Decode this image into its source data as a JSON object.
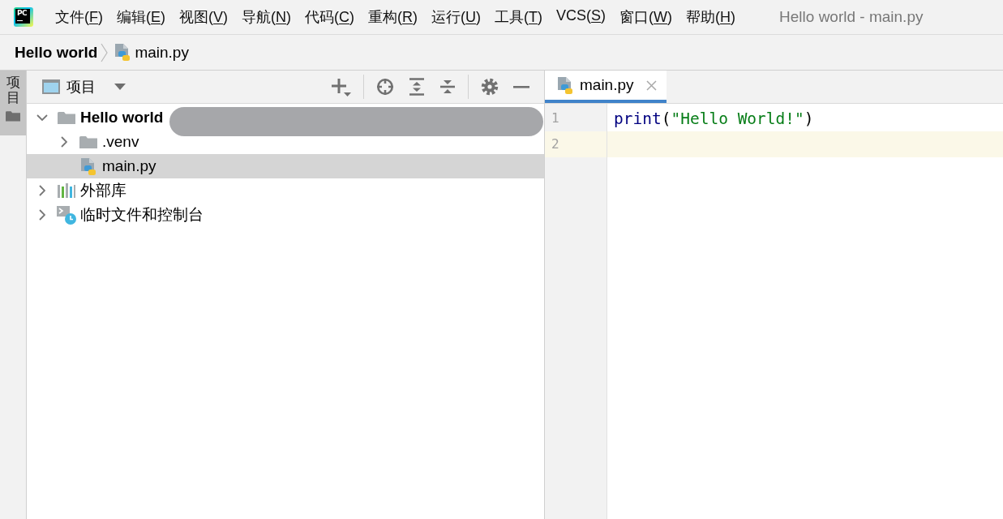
{
  "app": {
    "logo_text": "PC"
  },
  "menu": [
    {
      "before": "文件(",
      "mnemonic": "F",
      "after": ")"
    },
    {
      "before": "编辑(",
      "mnemonic": "E",
      "after": ")"
    },
    {
      "before": "视图(",
      "mnemonic": "V",
      "after": ")"
    },
    {
      "before": "导航(",
      "mnemonic": "N",
      "after": ")"
    },
    {
      "before": "代码(",
      "mnemonic": "C",
      "after": ")"
    },
    {
      "before": "重构(",
      "mnemonic": "R",
      "after": ")"
    },
    {
      "before": "运行(",
      "mnemonic": "U",
      "after": ")"
    },
    {
      "before": "工具(",
      "mnemonic": "T",
      "after": ")"
    },
    {
      "before": "VCS(",
      "mnemonic": "S",
      "after": ")"
    },
    {
      "before": "窗口(",
      "mnemonic": "W",
      "after": ")"
    },
    {
      "before": "帮助(",
      "mnemonic": "H",
      "after": ")"
    }
  ],
  "window": {
    "title": "Hello world - main.py"
  },
  "breadcrumbs": [
    {
      "kind": "project",
      "label": "Hello world"
    },
    {
      "kind": "python-file",
      "label": "main.py"
    }
  ],
  "tool_stripe": {
    "tabs": [
      {
        "label": "项目",
        "selected": true
      }
    ]
  },
  "project": {
    "view_label": "项目",
    "tree": [
      {
        "kind": "project",
        "label": "Hello world",
        "expanded": true,
        "selected": false,
        "redacted": true,
        "children": [
          {
            "kind": "folder",
            "label": ".venv",
            "expanded": false,
            "selected": false,
            "redacted": false
          },
          {
            "kind": "python-file",
            "label": "main.py",
            "selected": true,
            "redacted": false
          }
        ]
      },
      {
        "kind": "library",
        "label": "外部库",
        "expanded": false,
        "selected": false,
        "redacted": false
      },
      {
        "kind": "scratches",
        "label": "临时文件和控制台",
        "expanded": false,
        "selected": false,
        "redacted": false
      }
    ]
  },
  "editor": {
    "tabs": [
      {
        "label": "main.py",
        "selected": true
      }
    ],
    "lines": [
      {
        "number": "1",
        "current": false,
        "tokens": [
          {
            "kind": "function",
            "text": "print"
          },
          {
            "kind": "punct",
            "text": "("
          },
          {
            "kind": "string",
            "text": "\"Hello World!\""
          },
          {
            "kind": "punct",
            "text": ")"
          }
        ]
      },
      {
        "number": "2",
        "current": true
      }
    ]
  }
}
